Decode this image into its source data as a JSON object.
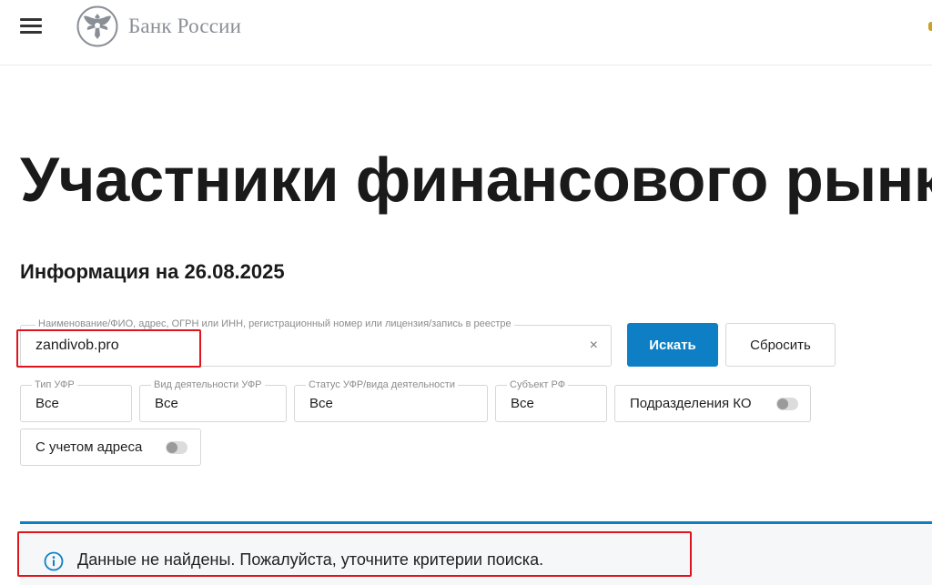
{
  "header": {
    "logo_text": "Банк России",
    "accent_color": "#c9a227"
  },
  "page": {
    "title": "Участники финансового рынка",
    "info_date": "Информация на 26.08.2025"
  },
  "search": {
    "label": "Наименование/ФИО, адрес, ОГРН или ИНН, регистрационный номер или лицензия/запись в реестре",
    "value": "zandivob.pro",
    "clear_symbol": "×",
    "search_button": "Искать",
    "reset_button": "Сбросить",
    "button_color": "#0e7fc4"
  },
  "filters": [
    {
      "label": "Тип УФР",
      "value": "Все"
    },
    {
      "label": "Вид деятельности УФР",
      "value": "Все"
    },
    {
      "label": "Статус УФР/вида деятельности",
      "value": "Все"
    },
    {
      "label": "Субъект РФ",
      "value": "Все"
    }
  ],
  "toggles": [
    {
      "label": "Подразделения КО",
      "enabled": false
    },
    {
      "label": "С учетом адреса",
      "enabled": false
    }
  ],
  "result": {
    "message": "Данные не найдены. Пожалуйста, уточните критерии поиска.",
    "icon": "info-icon"
  },
  "annotations": {
    "highlight_color": "#e0141c"
  }
}
